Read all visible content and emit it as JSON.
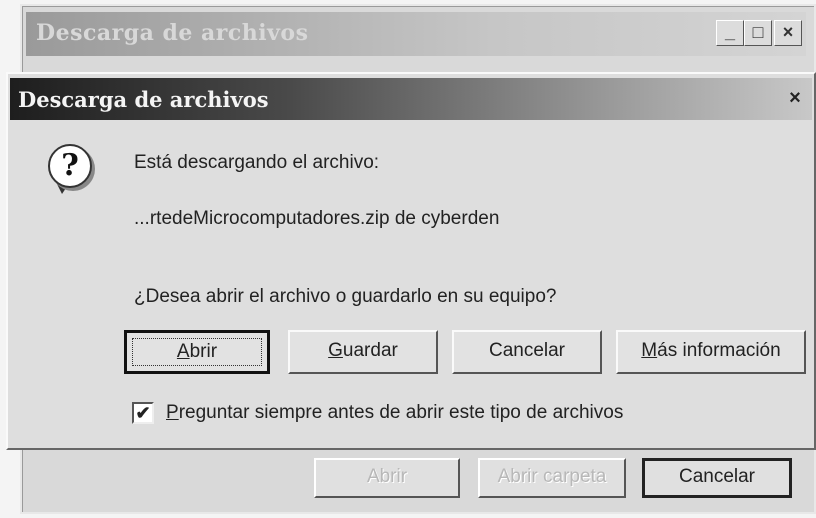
{
  "back_window": {
    "title": "Descarga de archivos",
    "minimize_glyph": "_",
    "maximize_glyph": "□",
    "close_glyph": "×",
    "buttons": {
      "open": "Abrir",
      "open_folder": "Abrir carpeta",
      "cancel": "Cancelar"
    }
  },
  "dialog": {
    "title": "Descarga de archivos",
    "close_glyph": "×",
    "icon": "question-icon",
    "icon_glyph": "?",
    "message_line1": "Está descargando el archivo:",
    "filename": "...rtedeMicrocomputadores.zip de cyberden",
    "question": "¿Desea abrir el archivo o guardarlo en su equipo?",
    "buttons": {
      "open_mnemonic": "A",
      "open_rest": "brir",
      "save_mnemonic": "G",
      "save_rest": "uardar",
      "cancel": "Cancelar",
      "more_info_mnemonic": "M",
      "more_info_rest": "ás información"
    },
    "checkbox": {
      "checked": true,
      "mark": "✔",
      "label_mnemonic": "P",
      "label_rest": "reguntar siempre antes de abrir este tipo de archivos"
    }
  }
}
